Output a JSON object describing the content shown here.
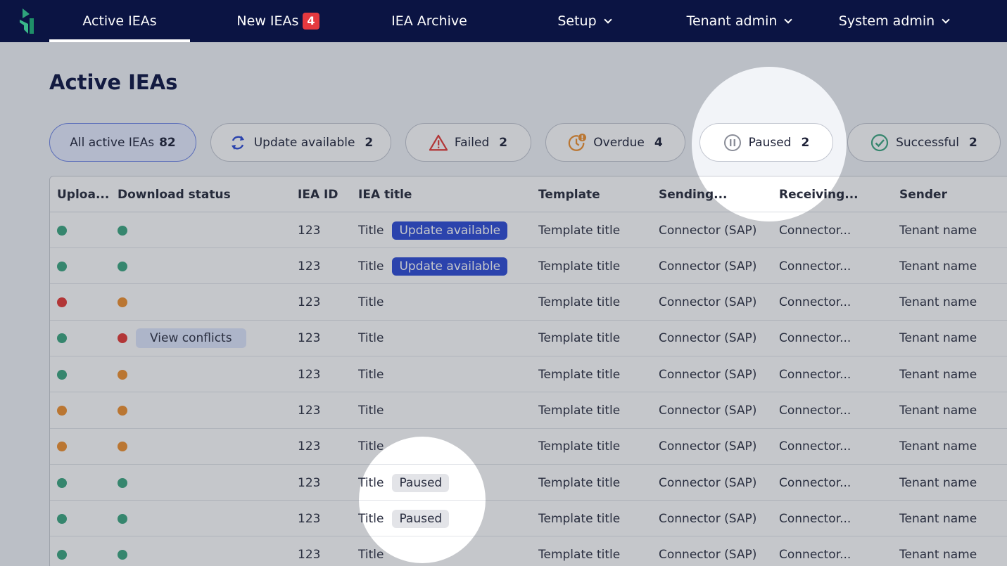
{
  "nav": {
    "items": [
      {
        "label": "Active IEAs"
      },
      {
        "label": "New IEAs",
        "badge": "4"
      },
      {
        "label": "IEA Archive"
      },
      {
        "label": "Setup"
      },
      {
        "label": "Tenant admin"
      },
      {
        "label": "System admin"
      }
    ]
  },
  "page": {
    "title": "Active IEAs"
  },
  "filters": [
    {
      "label": "All active IEAs",
      "count": "82",
      "icon": "none"
    },
    {
      "label": "Update available",
      "count": "2",
      "icon": "refresh-icon"
    },
    {
      "label": "Failed",
      "count": "2",
      "icon": "warning-icon"
    },
    {
      "label": "Overdue",
      "count": "4",
      "icon": "clock-alert-icon"
    },
    {
      "label": "Paused",
      "count": "2",
      "icon": "pause-icon"
    },
    {
      "label": "Successful",
      "count": "2",
      "icon": "check-circle-icon"
    }
  ],
  "table": {
    "headers": [
      "Uploa...",
      "Download status",
      "IEA ID",
      "IEA title",
      "Template",
      "Sending...",
      "Receiving...",
      "Sender"
    ],
    "rows": [
      {
        "upload": "green",
        "download": "green",
        "id": "123",
        "title": "Title",
        "tag": "Update available",
        "template": "Template title",
        "sending": "Connector (SAP)",
        "receiving": "Connector...",
        "sender": "Tenant name"
      },
      {
        "upload": "green",
        "download": "green",
        "id": "123",
        "title": "Title",
        "tag": "Update available",
        "template": "Template title",
        "sending": "Connector (SAP)",
        "receiving": "Connector...",
        "sender": "Tenant name"
      },
      {
        "upload": "red",
        "download": "orange",
        "id": "123",
        "title": "Title",
        "template": "Template title",
        "sending": "Connector (SAP)",
        "receiving": "Connector...",
        "sender": "Tenant name"
      },
      {
        "upload": "green",
        "download": "red",
        "conflicts": "View conflicts",
        "id": "123",
        "title": "Title",
        "template": "Template title",
        "sending": "Connector (SAP)",
        "receiving": "Connector...",
        "sender": "Tenant name"
      },
      {
        "upload": "green",
        "download": "orange",
        "id": "123",
        "title": "Title",
        "template": "Template title",
        "sending": "Connector (SAP)",
        "receiving": "Connector...",
        "sender": "Tenant name"
      },
      {
        "upload": "orange",
        "download": "orange",
        "id": "123",
        "title": "Title",
        "template": "Template title",
        "sending": "Connector (SAP)",
        "receiving": "Connector...",
        "sender": "Tenant name"
      },
      {
        "upload": "orange",
        "download": "orange",
        "id": "123",
        "title": "Title",
        "template": "Template title",
        "sending": "Connector (SAP)",
        "receiving": "Connector...",
        "sender": "Tenant name"
      },
      {
        "upload": "green",
        "download": "green",
        "id": "123",
        "title": "Title",
        "paused": "Paused",
        "template": "Template title",
        "sending": "Connector (SAP)",
        "receiving": "Connector...",
        "sender": "Tenant name"
      },
      {
        "upload": "green",
        "download": "green",
        "id": "123",
        "title": "Title",
        "paused": "Paused",
        "template": "Template title",
        "sending": "Connector (SAP)",
        "receiving": "Connector...",
        "sender": "Tenant name"
      },
      {
        "upload": "green",
        "download": "green",
        "id": "123",
        "title": "Title",
        "template": "Template title",
        "sending": "Connector (SAP)",
        "receiving": "Connector...",
        "sender": "Tenant name"
      }
    ]
  },
  "colors": {
    "nav_bg": "#0b1443",
    "accent": "#2c4ad6",
    "green": "#3ba680",
    "red": "#e53935",
    "orange": "#f0902e"
  }
}
